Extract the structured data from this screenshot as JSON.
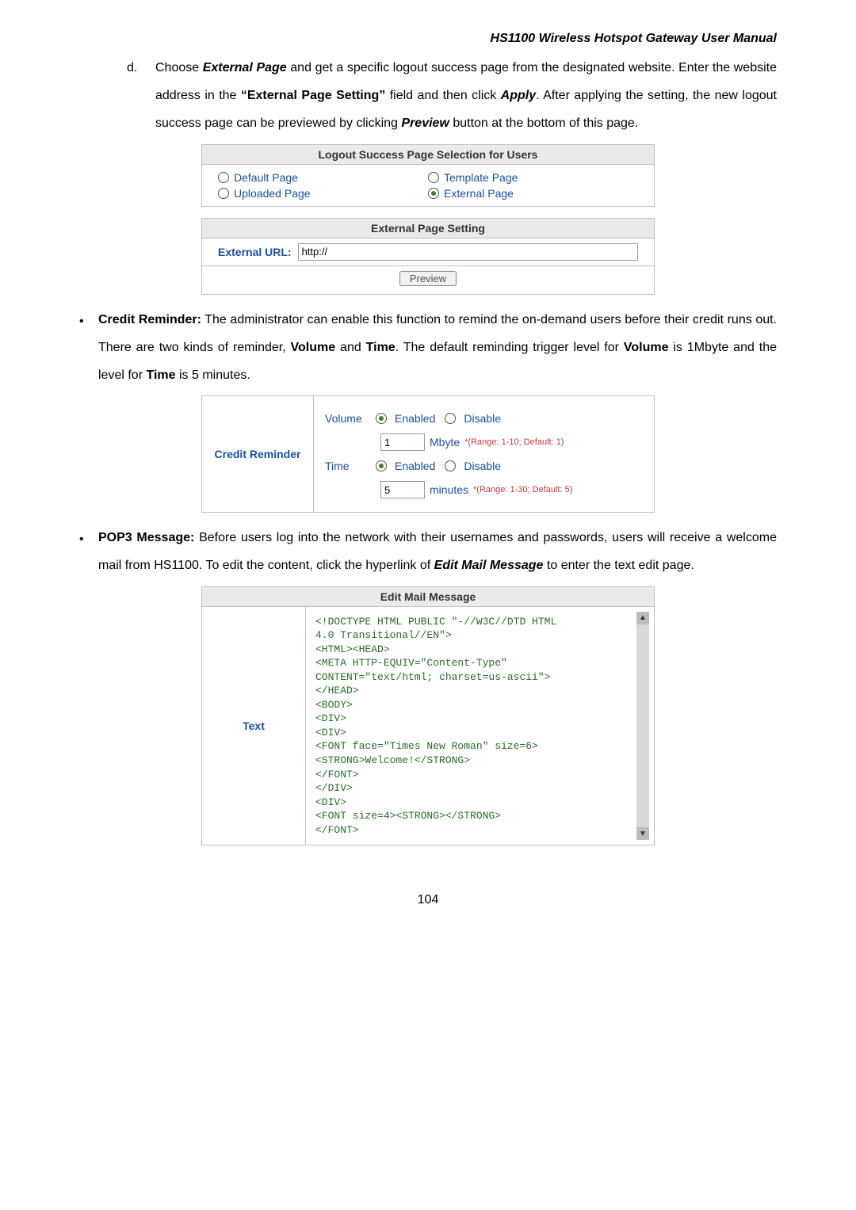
{
  "header": {
    "title": "HS1100  Wireless  Hotspot  Gateway  User  Manual"
  },
  "item_d": {
    "letter": "d.",
    "line1_pre": "Choose ",
    "line1_bold": "External Page",
    "line1_post": " and get a specific logout success page from the designated website. Enter the website address in the ",
    "line1_q": "“External Page Setting”",
    "line1_mid": " field and then click ",
    "line1_apply": "Apply",
    "line1_after_apply": ". After applying the setting, the new logout success page can be previewed by clicking ",
    "line1_preview": "Preview",
    "line1_end": " button at the bottom of this page."
  },
  "logout_panel": {
    "title": "Logout Success Page Selection for Users",
    "opts": {
      "default": "Default Page",
      "template": "Template Page",
      "uploaded": "Uploaded Page",
      "external": "External Page"
    }
  },
  "ext_panel": {
    "title": "External Page Setting",
    "label": "External URL:",
    "value": "http://",
    "button": "Preview"
  },
  "credit": {
    "heading": "Credit Reminder:",
    "text_a": " The administrator can enable this function to remind the on-demand users before their credit runs out. There are two kinds of reminder, ",
    "volume": "Volume",
    "and": " and ",
    "time": "Time",
    "text_b": ". The default reminding trigger level for ",
    "text_c": " is 1Mbyte and the level for ",
    "text_d": " is 5 minutes.",
    "box": {
      "left": "Credit Reminder",
      "volume_label": "Volume",
      "time_label": "Time",
      "enabled": "Enabled",
      "disable": "Disable",
      "vol_val": "1",
      "vol_unit": "Mbyte",
      "vol_range": "*(Range: 1-10; Default: 1)",
      "time_val": "5",
      "time_unit": "minutes",
      "time_range": "*(Range: 1-30; Default: 5)"
    }
  },
  "pop3": {
    "heading": "POP3 Message:",
    "text_a": " Before users log into the network with their usernames and passwords, users will receive a welcome mail from HS1100. To edit the content, click the hyperlink of ",
    "link": "Edit Mail Message",
    "text_b": " to enter the text edit page."
  },
  "mail": {
    "title": "Edit Mail Message",
    "left": "Text",
    "content": "<!DOCTYPE HTML PUBLIC \"-//W3C//DTD HTML\n4.0 Transitional//EN\">\n<HTML><HEAD>\n<META HTTP-EQUIV=\"Content-Type\"\nCONTENT=\"text/html; charset=us-ascii\">\n</HEAD>\n<BODY>\n<DIV>\n<DIV>\n<FONT face=\"Times New Roman\" size=6>\n<STRONG>Welcome!</STRONG>\n</FONT>\n</DIV>\n<DIV>\n<FONT size=4><STRONG></STRONG>\n</FONT>"
  },
  "page_number": "104"
}
